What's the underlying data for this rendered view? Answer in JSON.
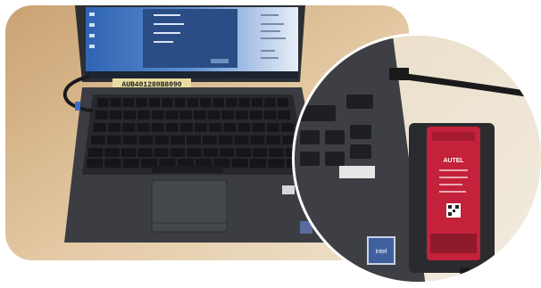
{
  "scene": {
    "asset_tag": "AUB401280B8090",
    "device_brand": "AUTEL",
    "processor_badge": "intel"
  },
  "colors": {
    "table": "#d8b98e",
    "laptop_body": "#3a3c40",
    "screen": "#3c6fb8",
    "device_red": "#c4213a",
    "cable": "#1a1a1a"
  }
}
